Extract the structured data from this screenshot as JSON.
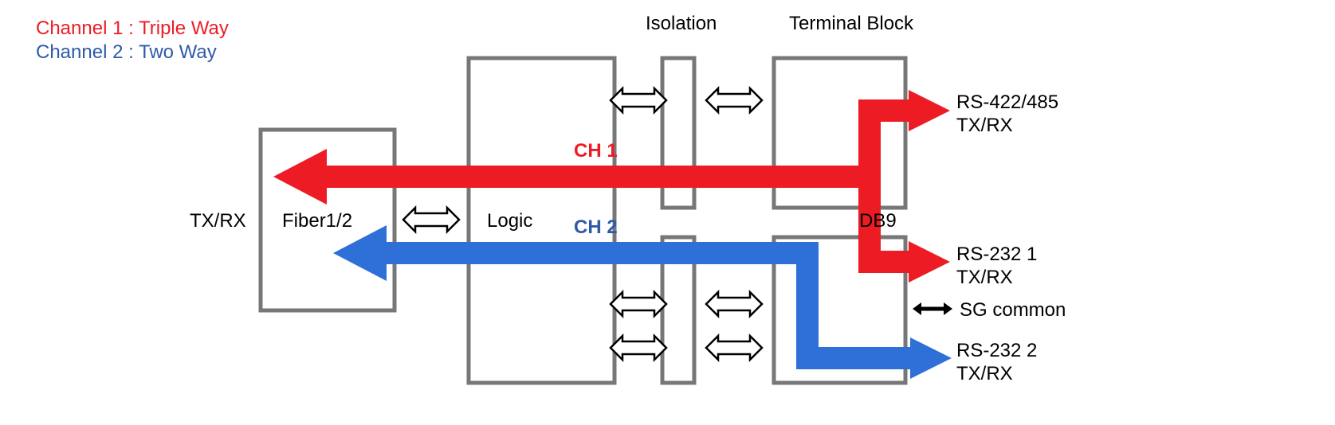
{
  "legend": {
    "ch1": "Channel 1 : Triple Way",
    "ch2": "Channel 2 : Two Way"
  },
  "blocks": {
    "fiber": "Fiber1/2",
    "logic": "Logic",
    "isolation": "Isolation",
    "terminal": "Terminal Block",
    "db9": "DB9"
  },
  "labels": {
    "txrx_left": "TX/RX",
    "ch1": "CH 1",
    "ch2": "CH 2",
    "sg_common": "SG common"
  },
  "ports": {
    "rs422_485_line1": "RS-422/485",
    "rs422_485_line2": "TX/RX",
    "rs232_1_line1": "RS-232  1",
    "rs232_1_line2": "TX/RX",
    "rs232_2_line1": "RS-232  2",
    "rs232_2_line2": "TX/RX"
  },
  "colors": {
    "box_stroke": "#777777",
    "red": "#ed1c24",
    "blue": "#2e70d8",
    "black_arrow": "#000000"
  }
}
